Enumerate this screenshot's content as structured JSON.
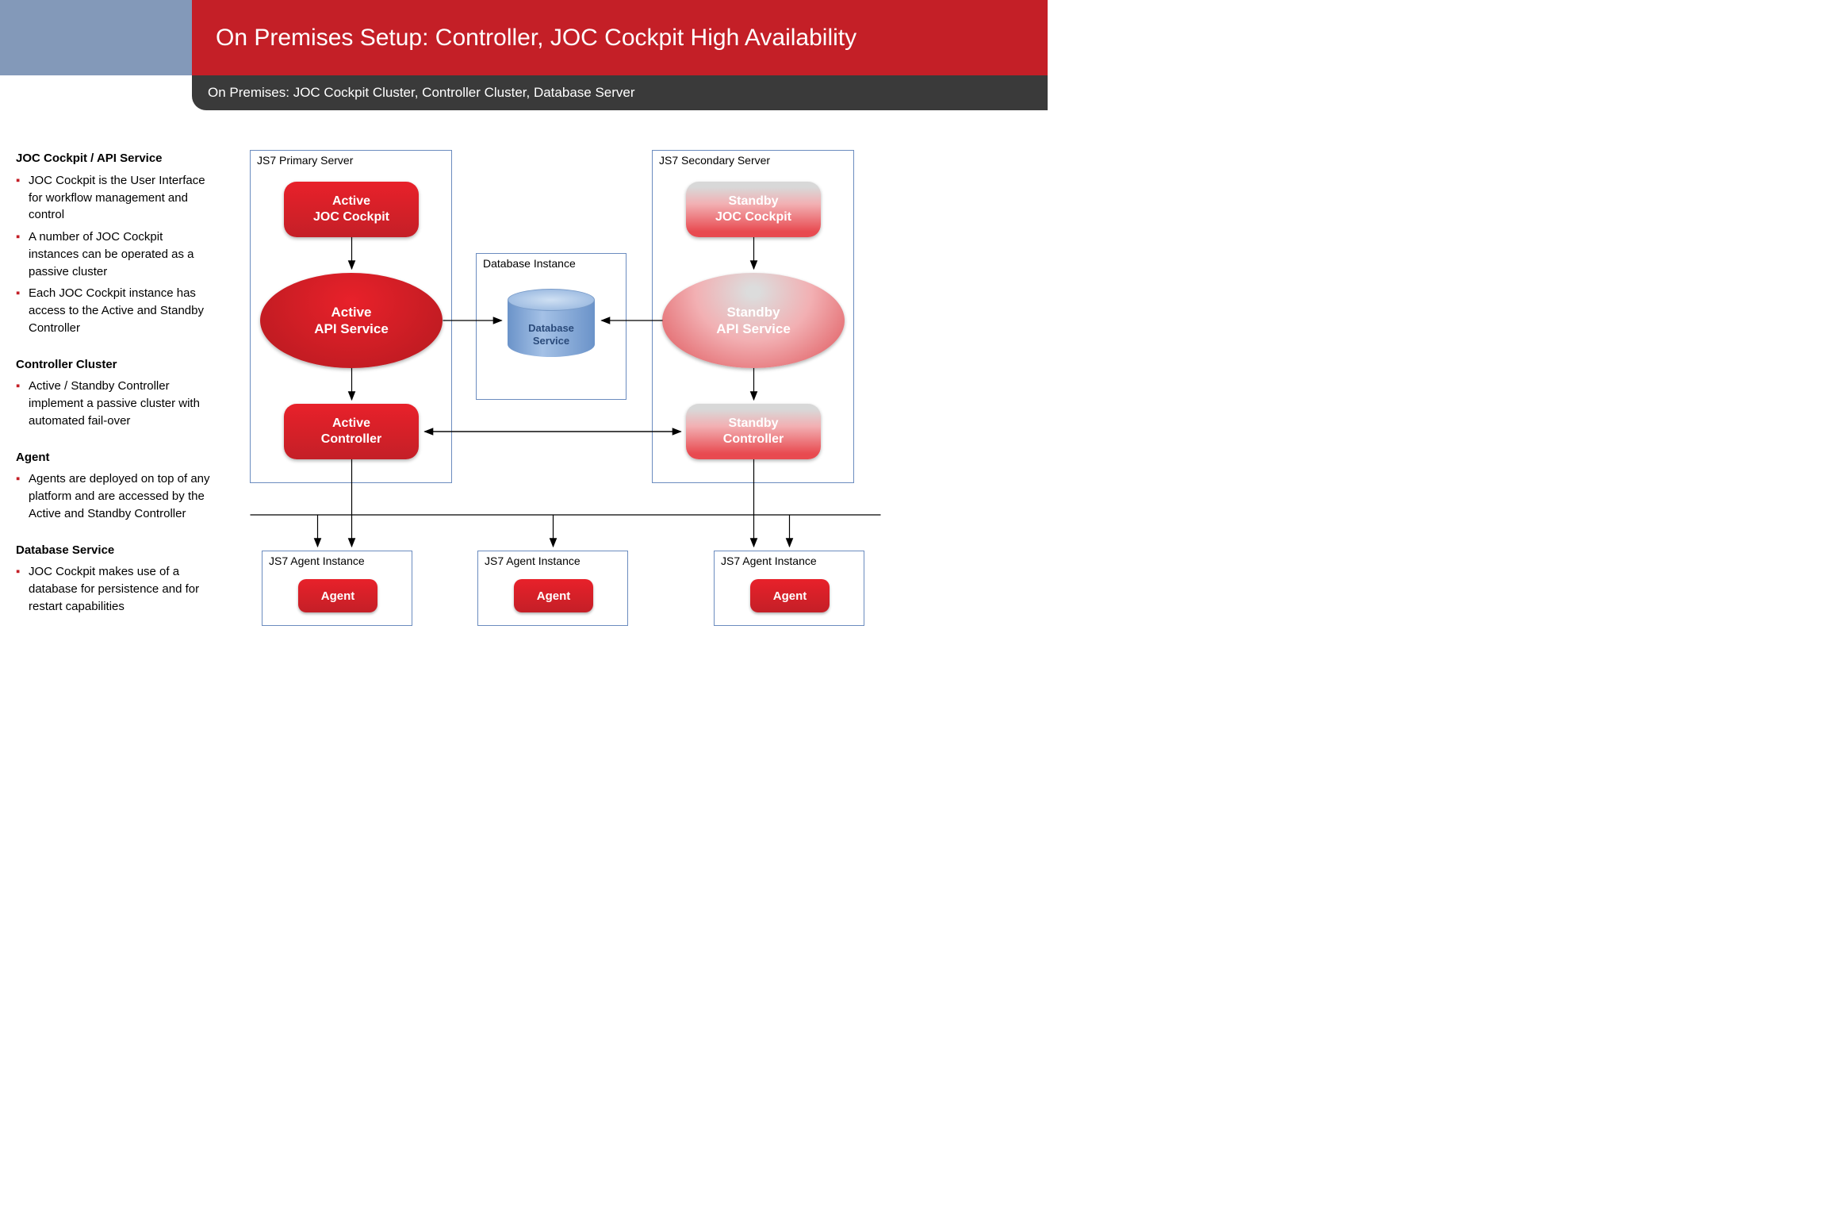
{
  "header": {
    "title": "On Premises Setup: Controller, JOC Cockpit High Availability",
    "subtitle": "On Premises: JOC Cockpit Cluster, Controller Cluster, Database Server"
  },
  "sections": [
    {
      "title": "JOC Cockpit / API Service",
      "bullets": [
        "JOC Cockpit is the User Interface for workflow management and control",
        "A number of JOC Cockpit instances can be operated as a passive cluster",
        "Each JOC Cockpit instance has access to the Active and Standby Controller"
      ]
    },
    {
      "title": "Controller Cluster",
      "bullets": [
        "Active / Standby Controller implement a passive cluster with automated fail-over"
      ]
    },
    {
      "title": "Agent",
      "bullets": [
        "Agents are deployed on top of any platform and are accessed by the Active and Standby Controller"
      ]
    },
    {
      "title": "Database Service",
      "bullets": [
        "JOC Cockpit makes use of a database for persistence and for restart capabilities"
      ]
    }
  ],
  "diagram": {
    "primary_label": "JS7 Primary Server",
    "secondary_label": "JS7 Secondary Server",
    "db_box_label": "Database Instance",
    "db_label_1": "Database",
    "db_label_2": "Service",
    "agent_box_label": "JS7 Agent Instance",
    "primary_joc_1": "Active",
    "primary_joc_2": "JOC Cockpit",
    "primary_api_1": "Active",
    "primary_api_2": "API Service",
    "primary_ctrl_1": "Active",
    "primary_ctrl_2": "Controller",
    "secondary_joc_1": "Standby",
    "secondary_joc_2": "JOC Cockpit",
    "secondary_api_1": "Standby",
    "secondary_api_2": "API Service",
    "secondary_ctrl_1": "Standby",
    "secondary_ctrl_2": "Controller",
    "agent_label": "Agent"
  }
}
